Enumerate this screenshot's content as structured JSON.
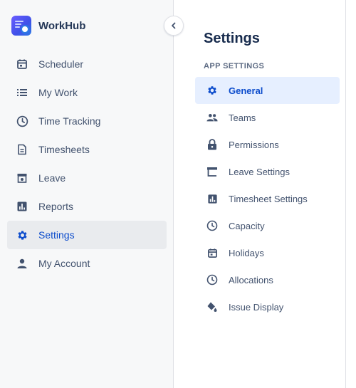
{
  "brand": {
    "name": "WorkHub",
    "logo_icon": "workhub-logo"
  },
  "collapse_icon": "chevron-left-icon",
  "sidebar": {
    "active_color": "#0c4ccc",
    "items": [
      {
        "label": "Scheduler",
        "icon": "calendar-icon"
      },
      {
        "label": "My Work",
        "icon": "list-icon"
      },
      {
        "label": "Time Tracking",
        "icon": "clock-icon"
      },
      {
        "label": "Timesheets",
        "icon": "document-icon"
      },
      {
        "label": "Leave",
        "icon": "leave-icon"
      },
      {
        "label": "Reports",
        "icon": "bar-chart-icon"
      },
      {
        "label": "Settings",
        "icon": "gear-icon",
        "active": true
      },
      {
        "label": "My Account",
        "icon": "person-icon"
      }
    ]
  },
  "main": {
    "title": "Settings",
    "section_label": "APP SETTINGS",
    "items": [
      {
        "label": "General",
        "icon": "gear-icon",
        "active": true
      },
      {
        "label": "Teams",
        "icon": "people-icon"
      },
      {
        "label": "Permissions",
        "icon": "lock-icon"
      },
      {
        "label": "Leave Settings",
        "icon": "leave-icon"
      },
      {
        "label": "Timesheet Settings",
        "icon": "bar-chart-icon"
      },
      {
        "label": "Capacity",
        "icon": "clock-icon"
      },
      {
        "label": "Holidays",
        "icon": "calendar-icon"
      },
      {
        "label": "Allocations",
        "icon": "clock-icon"
      },
      {
        "label": "Issue Display",
        "icon": "paint-bucket-icon"
      }
    ]
  }
}
